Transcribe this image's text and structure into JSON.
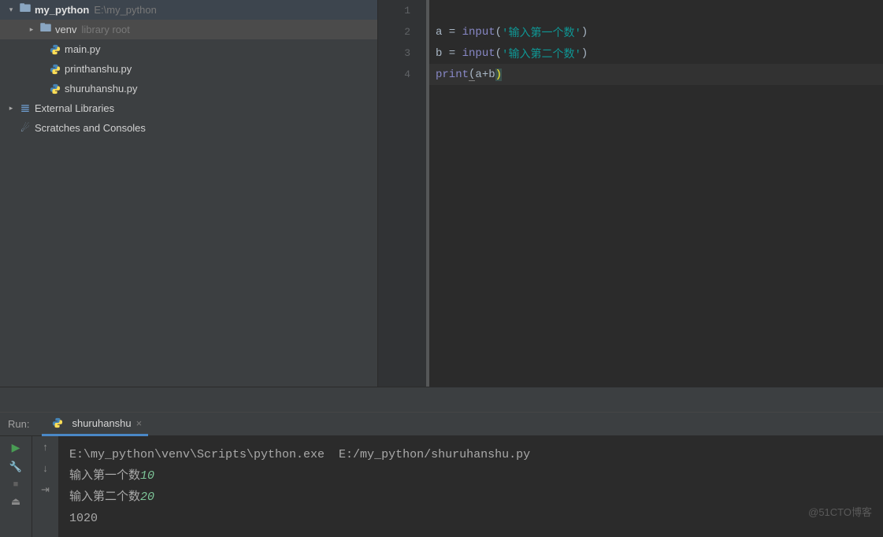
{
  "project": {
    "root": {
      "name": "my_python",
      "path": "E:\\my_python"
    },
    "venv": {
      "name": "venv",
      "hint": "library root"
    },
    "files": [
      "main.py",
      "printhanshu.py",
      "shuruhanshu.py"
    ],
    "ext": "External Libraries",
    "scratch": "Scratches and Consoles"
  },
  "editor": {
    "line_numbers": [
      "1",
      "2",
      "3",
      "4"
    ],
    "code": {
      "l2": {
        "var": "a",
        "op": " = ",
        "fn": "input",
        "p1": "(",
        "s": "'输入第一个数'",
        "p2": ")"
      },
      "l3": {
        "var": "b",
        "op": " = ",
        "fn": "input",
        "p1": "(",
        "s": "'输入第二个数'",
        "p2": ")"
      },
      "l4": {
        "fn": "print",
        "p1": "(",
        "e": "a+b",
        "p2": ")"
      }
    }
  },
  "run": {
    "label": "Run:",
    "tab": "shuruhanshu",
    "close": "×",
    "console": {
      "cmd": "E:\\my_python\\venv\\Scripts\\python.exe  E:/my_python/shuruhanshu.py",
      "p1": "输入第一个数",
      "i1": "10",
      "p2": "输入第二个数",
      "i2": "20",
      "out": "1020"
    }
  },
  "watermark": "@51CTO博客"
}
